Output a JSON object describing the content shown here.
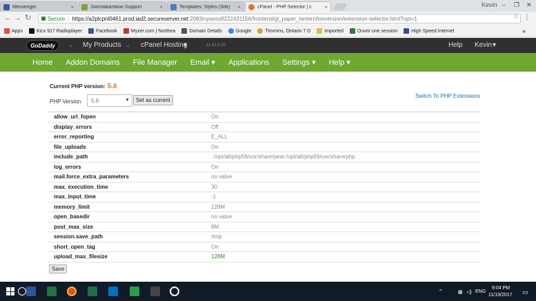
{
  "browser": {
    "tabs": [
      {
        "label": "Messenger",
        "color": "#3b5998",
        "active": false
      },
      {
        "label": "Joomlabamboo Support",
        "color": "#7aa43a",
        "active": false
      },
      {
        "label": "Templates: Styles (Site)",
        "color": "#4b7bbd",
        "active": false
      },
      {
        "label": "cPanel - PHP Selector | c",
        "color": "#e8702a",
        "active": true
      }
    ],
    "window_user": "Kevin",
    "address": {
      "secure_label": "Secure",
      "url_host": "https://a2plcpnl0461.prod.iad2.secureserver.net",
      "url_rest": ":2083/cpsess8222431156/frontend/gl_paper_lantern/lveversion/extension-selector.html?opt=1"
    },
    "bookmarks": [
      {
        "label": "Apps",
        "color": "#e94b3c"
      },
      {
        "label": "Kicx 917 Radioplayer",
        "color": "#111111"
      },
      {
        "label": "Facebook",
        "color": "#3b5998"
      },
      {
        "label": "Myzer.com | Northea",
        "color": "#c0392b"
      },
      {
        "label": "Domain Details",
        "color": "#555555"
      },
      {
        "label": "Google",
        "color": "#4285f4"
      },
      {
        "label": "Timmins, Ontario 7 D",
        "color": "#c8a92b"
      },
      {
        "label": "Imported",
        "color": "#e6b94f"
      },
      {
        "label": "Ouvrir une session",
        "color": "#2e7d32"
      },
      {
        "label": "High Speed Internet",
        "color": "#3949ab"
      }
    ]
  },
  "cpanel": {
    "logo": "GoDaddy",
    "crumbs": [
      "My Products",
      "cPanel Hosting"
    ],
    "crumb_caret": "▾",
    "version": "11.62.0.20",
    "help": "Help",
    "user": "Kevin",
    "nav": [
      "Home",
      "Addon Domains",
      "File Manager",
      "Email",
      "Applications",
      "Settings",
      "Help"
    ]
  },
  "php": {
    "current_label": "Current PHP version:",
    "current_value": "5.6",
    "select_label": "PHP Version",
    "selected": "5.6",
    "set_button": "Set as current",
    "switch_link": "Switch To PHP Extensions",
    "options": [
      {
        "key": "allow_url_fopen",
        "value": "On",
        "changed": false
      },
      {
        "key": "display_errors",
        "value": "Off",
        "changed": false
      },
      {
        "key": "error_reporting",
        "value": "E_ALL",
        "changed": false
      },
      {
        "key": "file_uploads",
        "value": "On",
        "changed": false
      },
      {
        "key": "include_path",
        "value": ".:/opt/alt/php56/usr/share/pear:/opt/alt/php56/usr/share/php",
        "changed": false
      },
      {
        "key": "log_errors",
        "value": "On",
        "changed": false
      },
      {
        "key": "mail.force_extra_parameters",
        "value": "no value",
        "changed": false
      },
      {
        "key": "max_execution_time",
        "value": "30",
        "changed": false
      },
      {
        "key": "max_input_time",
        "value": "-1",
        "changed": false
      },
      {
        "key": "memory_limit",
        "value": "128M",
        "changed": false
      },
      {
        "key": "open_basedir",
        "value": "no value",
        "changed": false
      },
      {
        "key": "post_max_size",
        "value": "8M",
        "changed": false
      },
      {
        "key": "session.save_path",
        "value": "/tmp",
        "changed": false
      },
      {
        "key": "short_open_tag",
        "value": "On",
        "changed": false
      },
      {
        "key": "upload_max_filesize",
        "value": "128M",
        "changed": true
      }
    ],
    "save_button": "Save"
  },
  "taskbar": {
    "time": "9:04 PM",
    "date": "11/19/2017",
    "lang": "ENG"
  }
}
